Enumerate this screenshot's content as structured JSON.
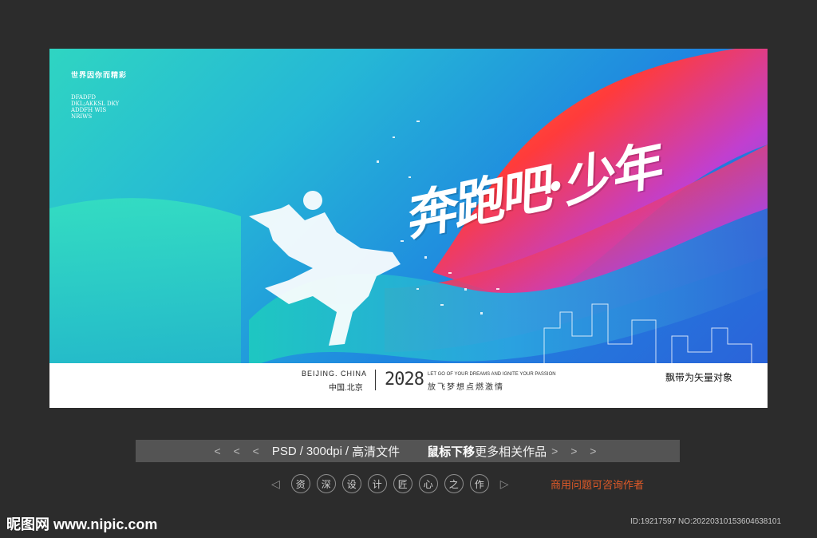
{
  "poster": {
    "top_left_title": "世界因你而精彩",
    "top_left_lines": [
      "DFADFD",
      "DKL;AKKSL DKY",
      "ADDFH WIS",
      "NRIWS"
    ],
    "headline": "奔跑吧·少年",
    "footer": {
      "beijing": "BEIJING. CHINA",
      "city_cn": "中国.北京",
      "year": "2028",
      "slogan_en": "LET GO OF YOUR DREAMS AND IGNITE YOUR PASSION",
      "slogan_cn": "放飞梦想点燃激情",
      "vector_note": "飘带为矢量对象"
    }
  },
  "infobar": {
    "left_arrows": "< < <",
    "format": "PSD",
    "dpi": "300dpi",
    "quality": "高清文件",
    "hint_bold": "鼠标下移",
    "hint_rest": "更多相关作品",
    "right_arrows": "> > >"
  },
  "labels": [
    "资",
    "深",
    "设",
    "计",
    "匠",
    "心",
    "之",
    "作"
  ],
  "consult": "商用问题可咨询作者",
  "site_logo": "昵图网 www.nipic.com",
  "id_text": "ID:19217597 NO:20220310153604638101"
}
